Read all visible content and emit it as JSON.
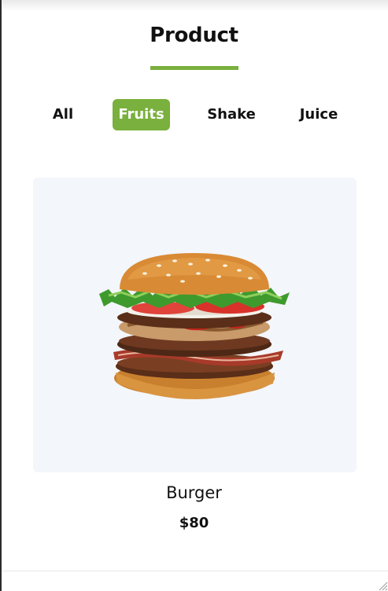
{
  "section": {
    "title": "Product"
  },
  "tabs": [
    {
      "label": "All",
      "active": false
    },
    {
      "label": "Fruits",
      "active": true
    },
    {
      "label": "Shake",
      "active": false
    },
    {
      "label": "Juice",
      "active": false
    }
  ],
  "product": {
    "name": "Burger",
    "price": "$80",
    "image_icon": "burger-image"
  },
  "colors": {
    "accent": "#7ab03d",
    "card_background": "#f3f6fa",
    "text": "#111111"
  }
}
